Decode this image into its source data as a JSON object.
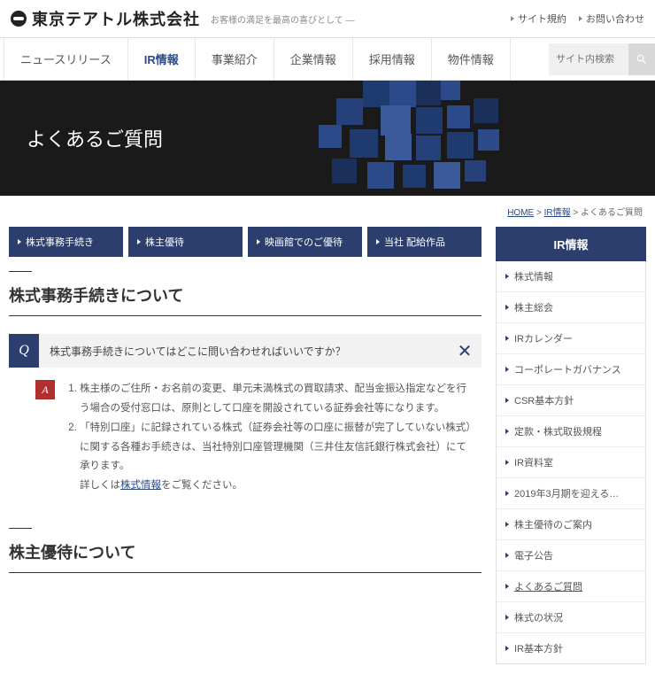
{
  "header": {
    "company": "東京テアトル株式会社",
    "tagline": "お客様の満足を最高の喜びとして —",
    "links": [
      "サイト規約",
      "お問い合わせ"
    ]
  },
  "nav": {
    "items": [
      "ニュースリリース",
      "IR情報",
      "事業紹介",
      "企業情報",
      "採用情報",
      "物件情報"
    ],
    "activeIndex": 1,
    "searchPlaceholder": "サイト内検索"
  },
  "hero": {
    "title": "よくあるご質問"
  },
  "breadcrumb": {
    "home": "HOME",
    "mid": "IR情報",
    "current": "よくあるご質問",
    "sep": " > "
  },
  "tabs": [
    "株式事務手続き",
    "株主優待",
    "映画館でのご優待",
    "当社 配給作品"
  ],
  "sections": [
    {
      "title": "株式事務手続きについて",
      "q": "株式事務手続きについてはどこに問い合わせればいいですか？",
      "a1": "株主様のご住所・お名前の変更、単元未満株式の買取請求、配当金振込指定などを行う場合の受付窓口は、原則として口座を開設されている証券会社等になります。",
      "a2_pre": "「特別口座」に記録されている株式（証券会社等の口座に振替が完了していない株式）に関する各種お手続きは、当社特別口座管理機関（三井住友信託銀行株式会社）にて承ります。",
      "a2_prefix": "詳しくは",
      "a2_link": "株式情報",
      "a2_suffix": "をご覧ください。"
    },
    {
      "title": "株主優待について"
    }
  ],
  "sidebar": {
    "heading": "IR情報",
    "items": [
      "株式情報",
      "株主総会",
      "IRカレンダー",
      "コーポレートガバナンス",
      "CSR基本方針",
      "定款・株式取扱規程",
      "IR資料室",
      "2019年3月期を迎える…",
      "株主優待のご案内",
      "電子公告",
      "よくあるご質問",
      "株式の状況",
      "IR基本方針"
    ],
    "currentIndex": 10
  }
}
